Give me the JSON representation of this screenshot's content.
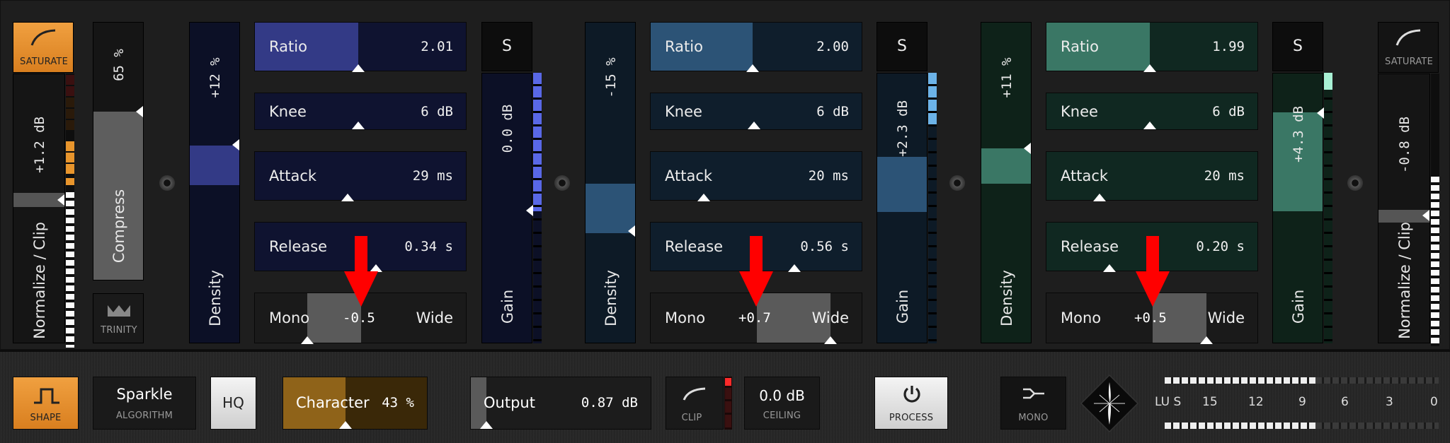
{
  "left_saturate": {
    "label": "SATURATE",
    "gain": "+1.2 dB",
    "mode": "Normalize / Clip",
    "accent": "#e8952c"
  },
  "compress": {
    "percent": "65 %",
    "label": "Compress"
  },
  "trinity": {
    "label": "TRINITY"
  },
  "bands": [
    {
      "density_value": "+12 %",
      "density_label": "Density",
      "ratio": {
        "label": "Ratio",
        "value": "2.01"
      },
      "knee": {
        "label": "Knee",
        "value": "6 dB"
      },
      "attack": {
        "label": "Attack",
        "value": "29 ms"
      },
      "release": {
        "label": "Release",
        "value": "0.34 s"
      },
      "stereo": {
        "mono": "Mono",
        "value": "-0.5",
        "wide": "Wide"
      },
      "solo": "S",
      "gain_value": "0.0 dB",
      "gain_label": "Gain",
      "color": "#333a86"
    },
    {
      "density_value": "-15 %",
      "density_label": "Density",
      "ratio": {
        "label": "Ratio",
        "value": "2.00"
      },
      "knee": {
        "label": "Knee",
        "value": "6 dB"
      },
      "attack": {
        "label": "Attack",
        "value": "20 ms"
      },
      "release": {
        "label": "Release",
        "value": "0.56 s"
      },
      "stereo": {
        "mono": "Mono",
        "value": "+0.7",
        "wide": "Wide"
      },
      "solo": "S",
      "gain_value": "+2.3 dB",
      "gain_label": "Gain",
      "color": "#2c5376"
    },
    {
      "density_value": "+11 %",
      "density_label": "Density",
      "ratio": {
        "label": "Ratio",
        "value": "1.99"
      },
      "knee": {
        "label": "Knee",
        "value": "6 dB"
      },
      "attack": {
        "label": "Attack",
        "value": "20 ms"
      },
      "release": {
        "label": "Release",
        "value": "0.20 s"
      },
      "stereo": {
        "mono": "Mono",
        "value": "+0.5",
        "wide": "Wide"
      },
      "solo": "S",
      "gain_value": "+4.3 dB",
      "gain_label": "Gain",
      "color": "#3a7765"
    }
  ],
  "right_saturate": {
    "label": "SATURATE",
    "gain": "-0.8 dB",
    "mode": "Normalize / Clip"
  },
  "bottom": {
    "shape": "SHAPE",
    "algorithm": {
      "value": "Sparkle",
      "label": "ALGORITHM"
    },
    "hq": "HQ",
    "character": {
      "label": "Character",
      "value": "43 %"
    },
    "output": {
      "label": "Output",
      "value": "0.87 dB"
    },
    "clip": "CLIP",
    "ceiling": {
      "value": "0.0 dB",
      "label": "CEILING"
    },
    "process": "PROCESS",
    "mono": "MONO",
    "loudness": {
      "label": "LU S",
      "ticks": [
        "15",
        "12",
        "9",
        "6",
        "3",
        "0"
      ]
    }
  },
  "annotation": {
    "color": "#ff0000"
  }
}
